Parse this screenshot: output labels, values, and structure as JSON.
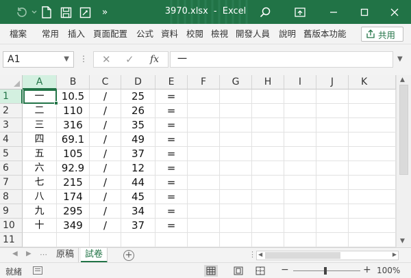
{
  "window": {
    "filename": "3970.xlsx",
    "separator": "-",
    "app": "Excel"
  },
  "ribbon": {
    "tabs": [
      "檔案",
      "常用",
      "插入",
      "頁面配置",
      "公式",
      "資料",
      "校閱",
      "檢視",
      "開發人員",
      "說明",
      "舊版本功能"
    ],
    "share_label": "共用"
  },
  "formula_bar": {
    "name_box": "A1",
    "content": "一"
  },
  "sheet": {
    "columns": [
      "A",
      "B",
      "C",
      "D",
      "E",
      "F",
      "G",
      "H",
      "I",
      "J",
      "K"
    ],
    "row_numbers": [
      "1",
      "2",
      "3",
      "4",
      "5",
      "6",
      "7",
      "8",
      "9",
      "10",
      "11"
    ],
    "rows": [
      [
        "一",
        "10.5",
        "/",
        "25",
        "="
      ],
      [
        "二",
        "110",
        "/",
        "26",
        "="
      ],
      [
        "三",
        "316",
        "/",
        "35",
        "="
      ],
      [
        "四",
        "69.1",
        "/",
        "49",
        "="
      ],
      [
        "五",
        "105",
        "/",
        "37",
        "="
      ],
      [
        "六",
        "92.9",
        "/",
        "12",
        "="
      ],
      [
        "七",
        "215",
        "/",
        "44",
        "="
      ],
      [
        "八",
        "174",
        "/",
        "45",
        "="
      ],
      [
        "九",
        "295",
        "/",
        "34",
        "="
      ],
      [
        "十",
        "349",
        "/",
        "37",
        "="
      ],
      [
        "",
        "",
        "",
        "",
        ""
      ]
    ]
  },
  "sheet_tabs": [
    "原稿",
    "試卷"
  ],
  "active_sheet": "試卷",
  "status": {
    "ready": "就緒",
    "zoom": "100%"
  },
  "colors": {
    "accent": "#217346",
    "selected_header_bg": "#d3f0e0"
  }
}
